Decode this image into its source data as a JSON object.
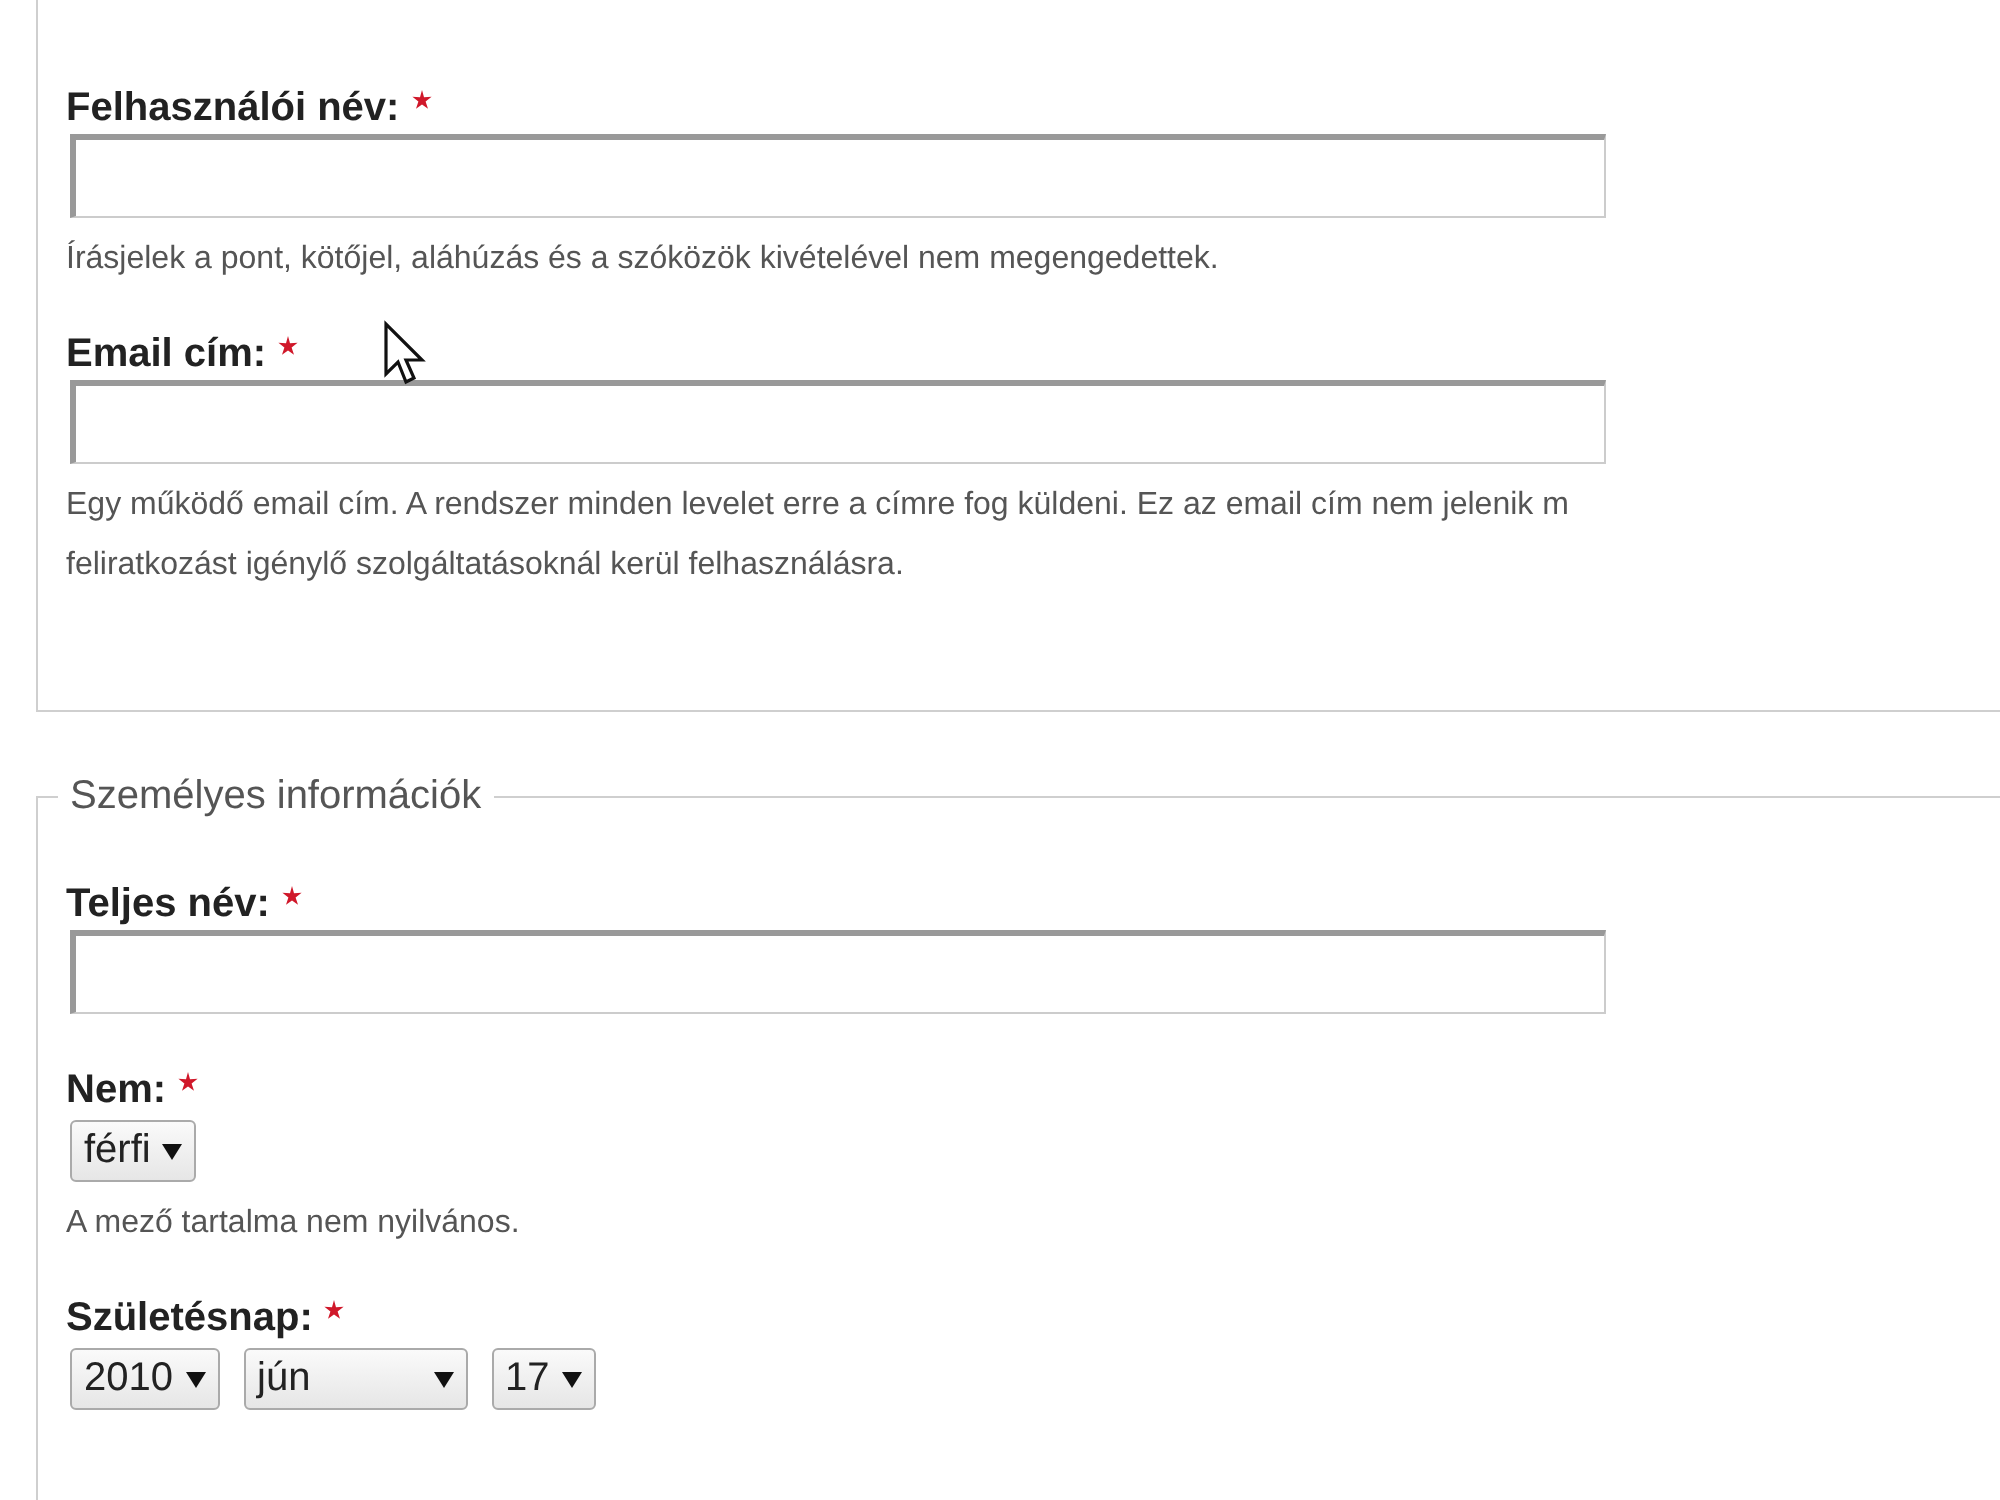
{
  "sections": [
    {
      "fields": [
        {
          "kind": "text",
          "label": "Felhasználói név:",
          "required": true,
          "description": [
            "Írásjelek a pont, kötőjel, aláhúzás és a szóközök kivételével nem megengedettek."
          ]
        },
        {
          "kind": "text",
          "label": "Email cím:",
          "required": true,
          "description": [
            "Egy működő email cím. A rendszer minden levelet erre a címre fog küldeni. Ez az email cím nem jelenik m",
            "feliratkozást igénylő szolgáltatásoknál kerül felhasználásra."
          ]
        }
      ]
    },
    {
      "legend": "Személyes információk",
      "fields": [
        {
          "kind": "text",
          "label": "Teljes név:",
          "required": true
        },
        {
          "kind": "select",
          "label": "Nem:",
          "required": true,
          "value": "férfi",
          "description": [
            "A mező tartalma nem nyilvános."
          ]
        },
        {
          "kind": "date",
          "label": "Születésnap:",
          "required": true,
          "selects": [
            "2010",
            "jún",
            "17"
          ]
        }
      ]
    }
  ]
}
